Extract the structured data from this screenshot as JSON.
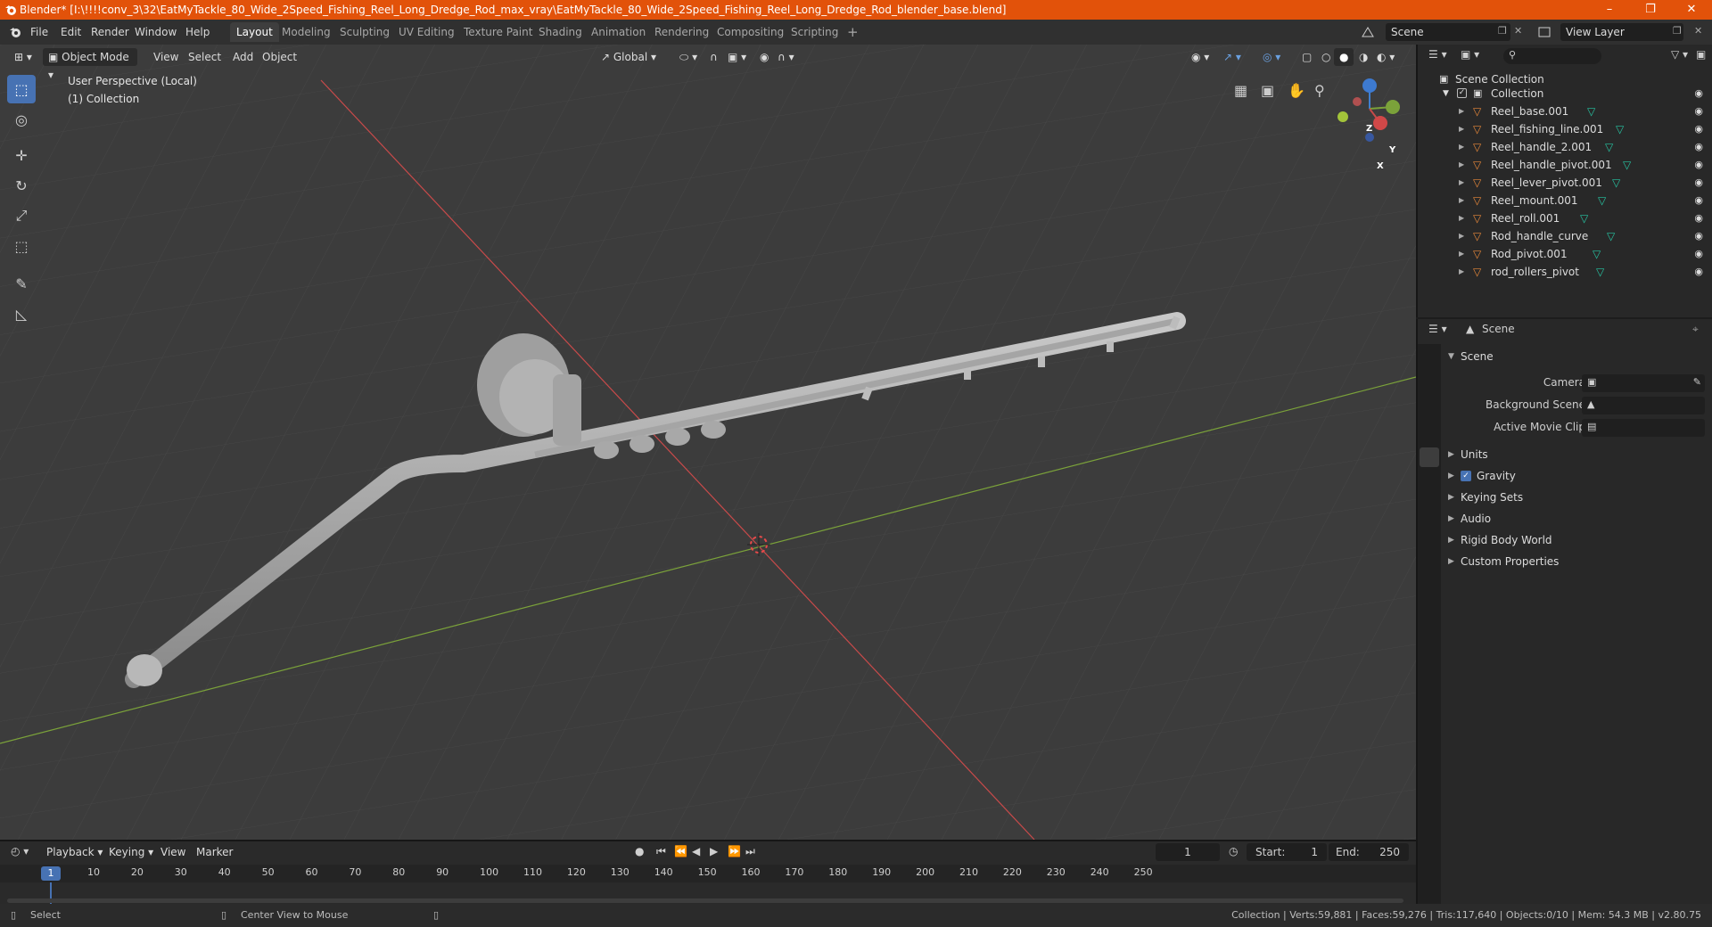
{
  "titlebar": {
    "title": "Blender* [I:\\!!!!conv_3\\32\\EatMyTackle_80_Wide_2Speed_Fishing_Reel_Long_Dredge_Rod_max_vray\\EatMyTackle_80_Wide_2Speed_Fishing_Reel_Long_Dredge_Rod_blender_base.blend]"
  },
  "menus": [
    "File",
    "Edit",
    "Render",
    "Window",
    "Help"
  ],
  "workspaces": [
    "Layout",
    "Modeling",
    "Sculpting",
    "UV Editing",
    "Texture Paint",
    "Shading",
    "Animation",
    "Rendering",
    "Compositing",
    "Scripting"
  ],
  "scene_name": "Scene",
  "view_layer": "View Layer",
  "viewport": {
    "mode": "Object Mode",
    "menus": [
      "View",
      "Select",
      "Add",
      "Object"
    ],
    "orientation": "Global",
    "info_line1": "User Perspective (Local)",
    "info_line2": "(1) Collection",
    "gizmo": {
      "x": "X",
      "y": "Y",
      "z": "Z"
    }
  },
  "outliner": {
    "root": "Scene Collection",
    "collection": "Collection",
    "items": [
      "Reel_base.001",
      "Reel_fishing_line.001",
      "Reel_handle_2.001",
      "Reel_handle_pivot.001",
      "Reel_lever_pivot.001",
      "Reel_mount.001",
      "Reel_roll.001",
      "Rod_handle_curve",
      "Rod_pivot.001",
      "rod_rollers_pivot"
    ]
  },
  "properties": {
    "header": "Scene",
    "panel_title": "Scene",
    "fields": [
      {
        "label": "Camera"
      },
      {
        "label": "Background Scene"
      },
      {
        "label": "Active Movie Clip"
      }
    ],
    "sections": [
      "Units",
      "Gravity",
      "Keying Sets",
      "Audio",
      "Rigid Body World",
      "Custom Properties"
    ]
  },
  "timeline": {
    "menus": [
      "Playback",
      "Keying",
      "View",
      "Marker"
    ],
    "current_frame": "1",
    "start_label": "Start:",
    "start": "1",
    "end_label": "End:",
    "end": "250",
    "ruler_current": "1",
    "ruler": [
      "10",
      "20",
      "30",
      "40",
      "50",
      "60",
      "70",
      "80",
      "90",
      "100",
      "110",
      "120",
      "130",
      "140",
      "150",
      "160",
      "170",
      "180",
      "190",
      "200",
      "210",
      "220",
      "230",
      "240",
      "250"
    ]
  },
  "statusbar": {
    "left1": "Select",
    "left2": "Center View to Mouse",
    "right": "Collection | Verts:59,881 | Faces:59,276 | Tris:117,640 | Objects:0/10 | Mem: 54.3 MB | v2.80.75"
  },
  "colors": {
    "accent": "#4772b3",
    "title_bar": "#e2520a",
    "mesh_icon": "#e8883a",
    "data_icon": "#27c4a2",
    "axis_x": "#c84a4a",
    "axis_y": "#7ba23a"
  }
}
